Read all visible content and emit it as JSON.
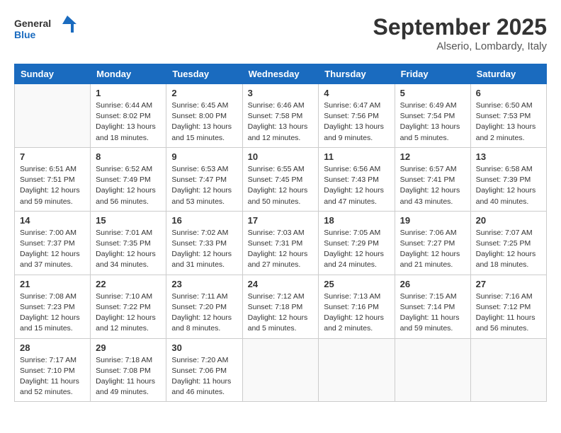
{
  "header": {
    "logo_line1": "General",
    "logo_line2": "Blue",
    "month": "September 2025",
    "location": "Alserio, Lombardy, Italy"
  },
  "weekdays": [
    "Sunday",
    "Monday",
    "Tuesday",
    "Wednesday",
    "Thursday",
    "Friday",
    "Saturday"
  ],
  "weeks": [
    [
      {
        "day": "",
        "empty": true
      },
      {
        "day": "1",
        "sunrise": "6:44 AM",
        "sunset": "8:02 PM",
        "daylight": "13 hours and 18 minutes."
      },
      {
        "day": "2",
        "sunrise": "6:45 AM",
        "sunset": "8:00 PM",
        "daylight": "13 hours and 15 minutes."
      },
      {
        "day": "3",
        "sunrise": "6:46 AM",
        "sunset": "7:58 PM",
        "daylight": "13 hours and 12 minutes."
      },
      {
        "day": "4",
        "sunrise": "6:47 AM",
        "sunset": "7:56 PM",
        "daylight": "13 hours and 9 minutes."
      },
      {
        "day": "5",
        "sunrise": "6:49 AM",
        "sunset": "7:54 PM",
        "daylight": "13 hours and 5 minutes."
      },
      {
        "day": "6",
        "sunrise": "6:50 AM",
        "sunset": "7:53 PM",
        "daylight": "13 hours and 2 minutes."
      }
    ],
    [
      {
        "day": "7",
        "sunrise": "6:51 AM",
        "sunset": "7:51 PM",
        "daylight": "12 hours and 59 minutes."
      },
      {
        "day": "8",
        "sunrise": "6:52 AM",
        "sunset": "7:49 PM",
        "daylight": "12 hours and 56 minutes."
      },
      {
        "day": "9",
        "sunrise": "6:53 AM",
        "sunset": "7:47 PM",
        "daylight": "12 hours and 53 minutes."
      },
      {
        "day": "10",
        "sunrise": "6:55 AM",
        "sunset": "7:45 PM",
        "daylight": "12 hours and 50 minutes."
      },
      {
        "day": "11",
        "sunrise": "6:56 AM",
        "sunset": "7:43 PM",
        "daylight": "12 hours and 47 minutes."
      },
      {
        "day": "12",
        "sunrise": "6:57 AM",
        "sunset": "7:41 PM",
        "daylight": "12 hours and 43 minutes."
      },
      {
        "day": "13",
        "sunrise": "6:58 AM",
        "sunset": "7:39 PM",
        "daylight": "12 hours and 40 minutes."
      }
    ],
    [
      {
        "day": "14",
        "sunrise": "7:00 AM",
        "sunset": "7:37 PM",
        "daylight": "12 hours and 37 minutes."
      },
      {
        "day": "15",
        "sunrise": "7:01 AM",
        "sunset": "7:35 PM",
        "daylight": "12 hours and 34 minutes."
      },
      {
        "day": "16",
        "sunrise": "7:02 AM",
        "sunset": "7:33 PM",
        "daylight": "12 hours and 31 minutes."
      },
      {
        "day": "17",
        "sunrise": "7:03 AM",
        "sunset": "7:31 PM",
        "daylight": "12 hours and 27 minutes."
      },
      {
        "day": "18",
        "sunrise": "7:05 AM",
        "sunset": "7:29 PM",
        "daylight": "12 hours and 24 minutes."
      },
      {
        "day": "19",
        "sunrise": "7:06 AM",
        "sunset": "7:27 PM",
        "daylight": "12 hours and 21 minutes."
      },
      {
        "day": "20",
        "sunrise": "7:07 AM",
        "sunset": "7:25 PM",
        "daylight": "12 hours and 18 minutes."
      }
    ],
    [
      {
        "day": "21",
        "sunrise": "7:08 AM",
        "sunset": "7:23 PM",
        "daylight": "12 hours and 15 minutes."
      },
      {
        "day": "22",
        "sunrise": "7:10 AM",
        "sunset": "7:22 PM",
        "daylight": "12 hours and 12 minutes."
      },
      {
        "day": "23",
        "sunrise": "7:11 AM",
        "sunset": "7:20 PM",
        "daylight": "12 hours and 8 minutes."
      },
      {
        "day": "24",
        "sunrise": "7:12 AM",
        "sunset": "7:18 PM",
        "daylight": "12 hours and 5 minutes."
      },
      {
        "day": "25",
        "sunrise": "7:13 AM",
        "sunset": "7:16 PM",
        "daylight": "12 hours and 2 minutes."
      },
      {
        "day": "26",
        "sunrise": "7:15 AM",
        "sunset": "7:14 PM",
        "daylight": "11 hours and 59 minutes."
      },
      {
        "day": "27",
        "sunrise": "7:16 AM",
        "sunset": "7:12 PM",
        "daylight": "11 hours and 56 minutes."
      }
    ],
    [
      {
        "day": "28",
        "sunrise": "7:17 AM",
        "sunset": "7:10 PM",
        "daylight": "11 hours and 52 minutes."
      },
      {
        "day": "29",
        "sunrise": "7:18 AM",
        "sunset": "7:08 PM",
        "daylight": "11 hours and 49 minutes."
      },
      {
        "day": "30",
        "sunrise": "7:20 AM",
        "sunset": "7:06 PM",
        "daylight": "11 hours and 46 minutes."
      },
      {
        "day": "",
        "empty": true
      },
      {
        "day": "",
        "empty": true
      },
      {
        "day": "",
        "empty": true
      },
      {
        "day": "",
        "empty": true
      }
    ]
  ]
}
